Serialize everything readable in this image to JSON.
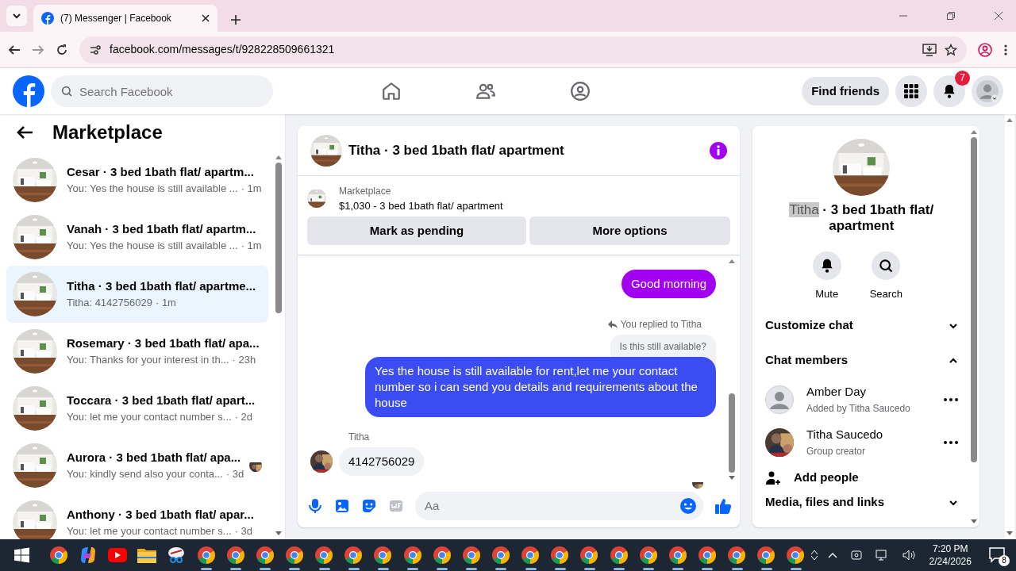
{
  "browser": {
    "tab_title": "(7) Messenger | Facebook",
    "url": "facebook.com/messages/t/928228509661321"
  },
  "header": {
    "search_placeholder": "Search Facebook",
    "find_friends": "Find friends",
    "notification_count": "7"
  },
  "sidebar": {
    "title": "Marketplace",
    "conversations": [
      {
        "title": "Cesar · 3 bed 1bath flat/ apartm...",
        "preview": "You: Yes the house is still available ...",
        "time": "· 1m",
        "selected": false,
        "seen_avatar": false
      },
      {
        "title": "Vanah · 3 bed 1bath flat/ apartm...",
        "preview": "You: Yes the house is still available ...",
        "time": "· 1m",
        "selected": false,
        "seen_avatar": false
      },
      {
        "title": "Titha · 3 bed 1bath flat/ apartme...",
        "preview": "Titha: 4142756029",
        "time": "· 1m",
        "selected": true,
        "seen_avatar": false
      },
      {
        "title": "Rosemary · 3 bed 1bath flat/ apa...",
        "preview": "You: Thanks for your interest in th...",
        "time": "· 23h",
        "selected": false,
        "seen_avatar": false
      },
      {
        "title": "Toccara · 3 bed 1bath flat/ apart...",
        "preview": "You: let me your contact number s...",
        "time": "· 2d",
        "selected": false,
        "seen_avatar": false
      },
      {
        "title": "Aurora · 3 bed 1bath flat/ apa...",
        "preview": "You: kindly send also your conta...",
        "time": "· 3d",
        "selected": false,
        "seen_avatar": true
      },
      {
        "title": "Anthony · 3 bed 1bath flat/ apar...",
        "preview": "You: let me your contact number s...",
        "time": "· 3d",
        "selected": false,
        "seen_avatar": false
      }
    ]
  },
  "chat": {
    "title": "Titha · 3 bed 1bath flat/ apartment",
    "listing": {
      "source": "Marketplace",
      "summary": "$1,030 - 3 bed 1bath flat/ apartment"
    },
    "actions": [
      "Mark as pending",
      "More options"
    ],
    "messages": [
      {
        "kind": "outgoing",
        "text": "Good morning",
        "color": "#a100f2"
      },
      {
        "kind": "reply_note",
        "text": "You replied to Titha"
      },
      {
        "kind": "quoted",
        "text": "Is this still available?"
      },
      {
        "kind": "outgoing",
        "text": "Yes the house is still available for rent,let me your contact number so i can send you details and requirements about the house",
        "color": "#3a4cf2"
      },
      {
        "kind": "sender",
        "text": "Titha"
      },
      {
        "kind": "incoming",
        "text": "4142756029"
      },
      {
        "kind": "read_receipt"
      }
    ],
    "composer_placeholder": "Aa"
  },
  "details": {
    "title_selected_part": "Titha",
    "title_rest": " · 3 bed 1bath flat/ apartment",
    "actions": [
      {
        "kind": "bell",
        "label": "Mute"
      },
      {
        "kind": "search",
        "label": "Search"
      }
    ],
    "sections": [
      {
        "label": "Customize chat",
        "expanded": false
      },
      {
        "label": "Chat members",
        "expanded": true
      }
    ],
    "members": [
      {
        "name": "Amber Day",
        "role": "Added by Titha Saucedo",
        "kind": "placeholder"
      },
      {
        "name": "Titha Saucedo",
        "role": "Group creator"
      }
    ],
    "add_people": "Add people",
    "last_section": {
      "label": "Media, files and links",
      "expanded": false
    }
  },
  "taskbar": {
    "apps": [
      {
        "kind": "chrome",
        "running": false
      },
      {
        "kind": "copilot",
        "running": false
      },
      {
        "kind": "youtube",
        "running": false
      },
      {
        "kind": "folder",
        "running": false
      },
      {
        "kind": "snip",
        "running": false
      },
      {
        "kind": "chrome",
        "running": true
      },
      {
        "kind": "chrome",
        "running": true
      },
      {
        "kind": "chrome",
        "running": true
      },
      {
        "kind": "chrome",
        "running": true
      },
      {
        "kind": "chrome",
        "running": true
      },
      {
        "kind": "chrome",
        "running": true
      },
      {
        "kind": "chrome",
        "running": true
      },
      {
        "kind": "chrome",
        "running": true
      },
      {
        "kind": "chrome",
        "running": true
      },
      {
        "kind": "chrome",
        "running": true
      },
      {
        "kind": "chrome",
        "running": true
      },
      {
        "kind": "chrome",
        "running": true
      },
      {
        "kind": "chrome",
        "running": true
      },
      {
        "kind": "chrome",
        "running": true
      },
      {
        "kind": "chrome",
        "running": true
      },
      {
        "kind": "chrome",
        "running": true
      },
      {
        "kind": "chrome",
        "running": true
      },
      {
        "kind": "chrome",
        "running": true
      },
      {
        "kind": "chrome",
        "running": true
      },
      {
        "kind": "chrome",
        "running": true
      },
      {
        "kind": "chrome",
        "running": true
      }
    ],
    "time": "7:20 PM",
    "date": "2/24/2026",
    "notification_count": "8"
  }
}
